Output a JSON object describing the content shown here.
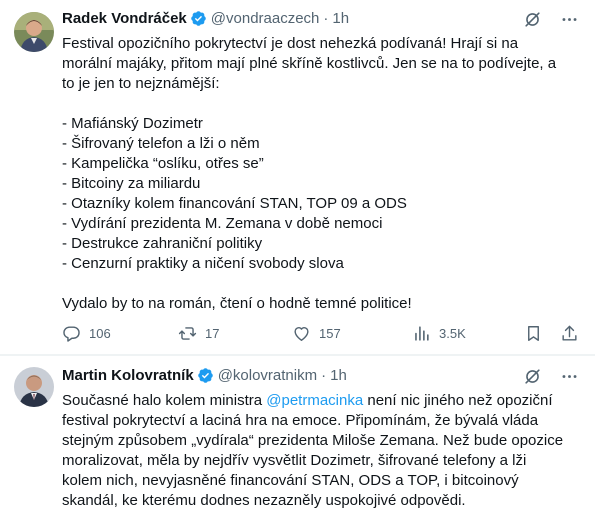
{
  "tweets": [
    {
      "author_name": "Radek Vondráček",
      "handle": "@vondraaczech",
      "separator": "·",
      "time": "1h",
      "lines": [
        "Festival opozičního pokrytectví je dost nehezká podívaná! Hrají si na",
        "morální majáky, přitom mají plné skříně kostlivců. Jen se na to podívejte, a",
        "to je jen to nejznámější:",
        "",
        "- Mafiánský Dozimetr",
        "- Šifrovaný telefon a lži o něm",
        "- Kampelička “oslíku, otřes se”",
        "- Bitcoiny za miliardu",
        "- Otazníky kolem financování STAN, TOP 09 a ODS",
        "- Vydírání prezidenta M. Zemana v době nemoci",
        "- Destrukce zahraniční politiky",
        "- Cenzurní praktiky a ničení svobody slova",
        "",
        "Vydalo by to na román, čtení o hodně temné politice!"
      ],
      "actions": {
        "replies": "106",
        "reposts": "17",
        "likes": "157",
        "views": "3.5K"
      }
    },
    {
      "author_name": "Martin Kolovratník",
      "handle": "@kolovratnikm",
      "separator": "·",
      "time": "1h",
      "text_line1_before": "Současné halo kolem ministra ",
      "mention": "@petrmacinka",
      "text_line1_after": " není nic jiného než opoziční",
      "lines": [
        "festival pokrytectví a laciná hra na emoce. Připomínám, že bývalá vláda",
        "stejným způsobem „vydírala“ prezidenta Miloše Zemana. Než bude opozice",
        "moralizovat, měla by nejdřív vysvětlit Dozimetr, šifrované telefony a lži",
        "kolem nich, nevyjasněné financování STAN, ODS a TOP, i bitcoinový",
        "skandál, ke kterému dodnes nezazněly uspokojivé odpovědi."
      ]
    }
  ],
  "colors": {
    "text": "#0f1419",
    "secondary": "#536471",
    "verified_badge": "#1d9bf0",
    "mention": "#1d9bf0",
    "divider": "#eff3f4"
  },
  "icons": [
    "verified-badge-icon",
    "grok-icon",
    "more-icon",
    "reply-icon",
    "repost-icon",
    "like-icon",
    "views-icon",
    "bookmark-icon",
    "share-icon"
  ]
}
